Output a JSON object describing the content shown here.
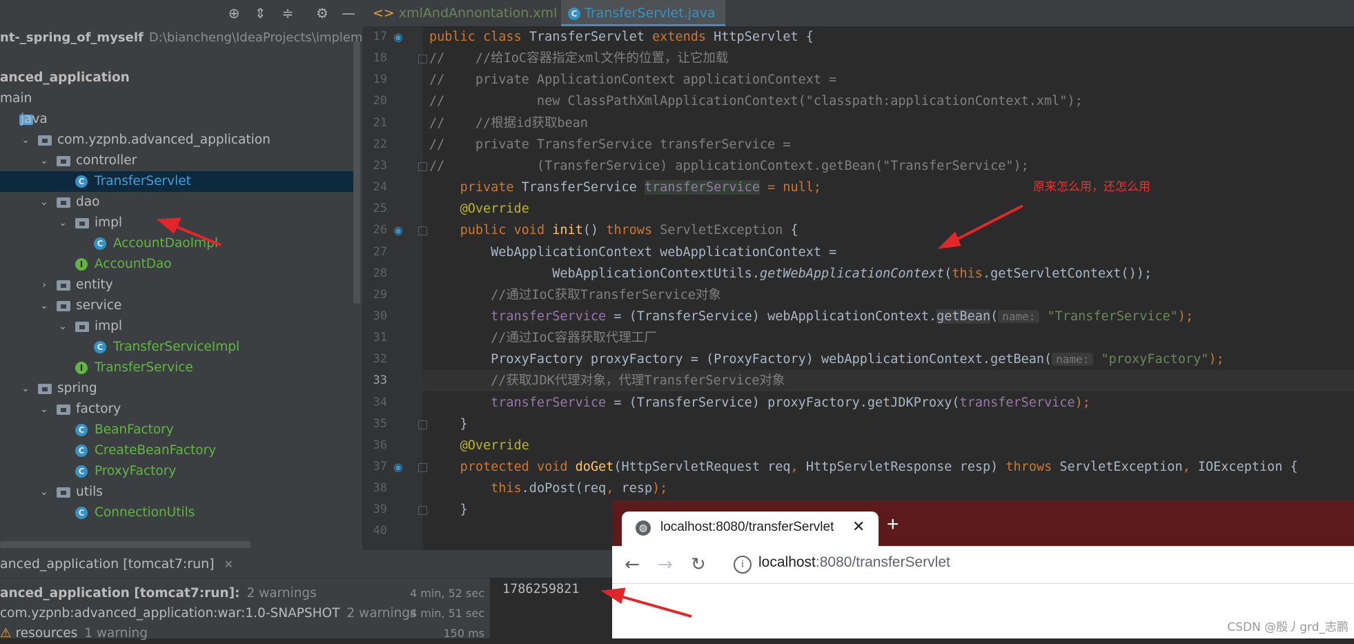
{
  "project": {
    "root_name": "nt-_spring_of_myself",
    "root_path": "D:\\biancheng\\IdeaProjects\\implement",
    "toolbar_icons": [
      "target-icon",
      "expand-all-icon",
      "collapse-all-icon",
      "gear-icon",
      "minimize-icon"
    ],
    "tree": [
      {
        "label": "anced_application",
        "type": "module",
        "indent": 0,
        "bold": true,
        "arrow": ""
      },
      {
        "label": "main",
        "type": "text",
        "indent": 0,
        "arrow": ""
      },
      {
        "label": "java",
        "type": "folder-blue",
        "indent": 0,
        "arrow": ""
      },
      {
        "label": "com.yzpnb.advanced_application",
        "type": "package",
        "indent": 1,
        "arrow": "down"
      },
      {
        "label": "controller",
        "type": "package",
        "indent": 2,
        "arrow": "down"
      },
      {
        "label": "TransferServlet",
        "type": "class",
        "indent": 3,
        "selected": true
      },
      {
        "label": "dao",
        "type": "package",
        "indent": 2,
        "arrow": "down"
      },
      {
        "label": "impl",
        "type": "package",
        "indent": 3,
        "arrow": "down"
      },
      {
        "label": "AccountDaoImpl",
        "type": "class",
        "indent": 4
      },
      {
        "label": "AccountDao",
        "type": "interface",
        "indent": 3
      },
      {
        "label": "entity",
        "type": "package",
        "indent": 2,
        "arrow": "right"
      },
      {
        "label": "service",
        "type": "package",
        "indent": 2,
        "arrow": "down"
      },
      {
        "label": "impl",
        "type": "package",
        "indent": 3,
        "arrow": "down"
      },
      {
        "label": "TransferServiceImpl",
        "type": "class",
        "indent": 4
      },
      {
        "label": "TransferService",
        "type": "interface",
        "indent": 3
      },
      {
        "label": "spring",
        "type": "package",
        "indent": 1,
        "arrow": "down"
      },
      {
        "label": "factory",
        "type": "package",
        "indent": 2,
        "arrow": "down"
      },
      {
        "label": "BeanFactory",
        "type": "class",
        "indent": 3
      },
      {
        "label": "CreateBeanFactory",
        "type": "class",
        "indent": 3
      },
      {
        "label": "ProxyFactory",
        "type": "class",
        "indent": 3
      },
      {
        "label": "utils",
        "type": "package",
        "indent": 2,
        "arrow": "down"
      },
      {
        "label": "ConnectionUtils",
        "type": "class",
        "indent": 3
      }
    ]
  },
  "tabs": [
    {
      "label": "xmlAndAnnontation.xml",
      "active": false,
      "icon": "xml-file-icon"
    },
    {
      "label": "TransferServlet.java",
      "active": true,
      "icon": "java-class-icon"
    }
  ],
  "editor": {
    "current_line": "33",
    "line_numbers": [
      "17",
      "18",
      "19",
      "20",
      "21",
      "22",
      "23",
      "24",
      "25",
      "26",
      "27",
      "28",
      "29",
      "30",
      "31",
      "32",
      "33",
      "34",
      "35",
      "36",
      "37",
      "38",
      "39",
      "40"
    ],
    "annotation_note": "原来怎么用，还怎么用",
    "lines": [
      {
        "t": [
          [
            "kw",
            "public class "
          ],
          [
            "",
            "TransferServlet "
          ],
          [
            "kw",
            "extends "
          ],
          [
            "",
            "HttpServlet {"
          ]
        ]
      },
      {
        "t": [
          [
            "cm",
            "//    //给IoC容器指定xml文件的位置，让它加载"
          ]
        ]
      },
      {
        "t": [
          [
            "cm",
            "//    private ApplicationContext applicationContext ="
          ]
        ]
      },
      {
        "t": [
          [
            "cm",
            "//            new ClassPathXmlApplicationContext(\"classpath:applicationContext.xml\");"
          ]
        ]
      },
      {
        "t": [
          [
            "cm",
            "//    //根据id获取bean"
          ]
        ]
      },
      {
        "t": [
          [
            "cm",
            "//    private TransferService transferService ="
          ]
        ]
      },
      {
        "t": [
          [
            "cm",
            "//            (TransferService) applicationContext.getBean(\"TransferService\");"
          ]
        ]
      },
      {
        "t": [
          [
            "",
            "    "
          ],
          [
            "kw",
            "private "
          ],
          [
            "",
            "TransferService "
          ],
          [
            "fld hl-field",
            "transferService"
          ],
          [
            "",
            ""
          ],
          [
            "kw",
            " = null;"
          ]
        ]
      },
      {
        "t": [
          [
            "",
            "    "
          ],
          [
            "ann",
            "@Override"
          ]
        ]
      },
      {
        "t": [
          [
            "",
            "    "
          ],
          [
            "kw",
            "public void "
          ],
          [
            "fn",
            "init"
          ],
          [
            "",
            "() "
          ],
          [
            "kw",
            "throws "
          ],
          [
            "cm",
            "ServletException"
          ],
          [
            "",
            " {"
          ]
        ]
      },
      {
        "t": [
          [
            "",
            "        WebApplicationContext webApplicationContext ="
          ]
        ]
      },
      {
        "t": [
          [
            "",
            "                WebApplicationContextUtils."
          ],
          [
            "it",
            "getWebApplicationContext"
          ],
          [
            "",
            "("
          ],
          [
            "kw",
            "this"
          ],
          [
            "",
            ".getServletContext());"
          ]
        ]
      },
      {
        "t": [
          [
            "",
            "        "
          ],
          [
            "cm",
            "//通过IoC获取TransferService对象"
          ]
        ]
      },
      {
        "t": [
          [
            "",
            "        "
          ],
          [
            "fld",
            "transferService"
          ],
          [
            "",
            " = (TransferService) webApplicationContext."
          ],
          [
            "hl-get",
            "getBean"
          ],
          [
            "",
            "("
          ],
          [
            "hint",
            "name:"
          ],
          [
            "str",
            " \"TransferService\""
          ],
          [
            "kw",
            ");"
          ]
        ]
      },
      {
        "t": [
          [
            "",
            "        "
          ],
          [
            "cm",
            "//通过IoC容器获取代理工厂"
          ]
        ]
      },
      {
        "t": [
          [
            "",
            "        ProxyFactory proxyFactory = (ProxyFactory) webApplicationContext.getBean("
          ],
          [
            "hint",
            "name:"
          ],
          [
            "str",
            " \"proxyFactory\""
          ],
          [
            "kw",
            ");"
          ]
        ]
      },
      {
        "t": [
          [
            "",
            "        "
          ],
          [
            "cm",
            "//获取JDK代理对象，代理TransferService对象"
          ]
        ]
      },
      {
        "t": [
          [
            "",
            "        "
          ],
          [
            "fld",
            "transferService"
          ],
          [
            "",
            " = (TransferService) proxyFactory.getJDKProxy("
          ],
          [
            "fld",
            "transferService"
          ],
          [
            "kw",
            ");"
          ]
        ]
      },
      {
        "t": [
          [
            "",
            "    }"
          ]
        ]
      },
      {
        "t": [
          [
            "",
            "    "
          ],
          [
            "ann",
            "@Override"
          ]
        ]
      },
      {
        "t": [
          [
            "",
            "    "
          ],
          [
            "kw",
            "protected void "
          ],
          [
            "fn",
            "doGet"
          ],
          [
            "",
            "(HttpServletRequest req"
          ],
          [
            "kw",
            ", "
          ],
          [
            "",
            "HttpServletResponse resp) "
          ],
          [
            "kw",
            "throws "
          ],
          [
            "",
            "ServletException"
          ],
          [
            "kw",
            ", "
          ],
          [
            "",
            "IOException {"
          ]
        ]
      },
      {
        "t": [
          [
            "",
            "        "
          ],
          [
            "kw",
            "this"
          ],
          [
            "",
            ".doPost(req"
          ],
          [
            "kw",
            ", "
          ],
          [
            "",
            "resp"
          ],
          [
            "kw",
            ");"
          ]
        ]
      },
      {
        "t": [
          [
            "",
            "    }"
          ]
        ]
      },
      {
        "t": [
          [
            "",
            ""
          ]
        ]
      }
    ]
  },
  "run": {
    "tab_label": "anced_application [tomcat7:run]",
    "rows": [
      {
        "label": "anced_application [tomcat7:run]:",
        "warn": "2 warnings",
        "time": "4 min, 52 sec",
        "bold": true
      },
      {
        "label": "com.yzpnb:advanced_application:war:1.0-SNAPSHOT",
        "warn": "2 warnings",
        "time": "4 min, 51 sec"
      },
      {
        "label": "resources",
        "warn": "1 warning",
        "time": "150 ms"
      }
    ],
    "output": "1786259821"
  },
  "browser": {
    "tab_title": "localhost:8080/transferServlet",
    "url_host": "localhost",
    "url_rest": ":8080/transferServlet",
    "new_tab": "+",
    "close": "✕"
  },
  "watermark": "CSDN @殷丿grd_志鹏",
  "colors": {
    "annotation_arrow": "#e3262a"
  }
}
